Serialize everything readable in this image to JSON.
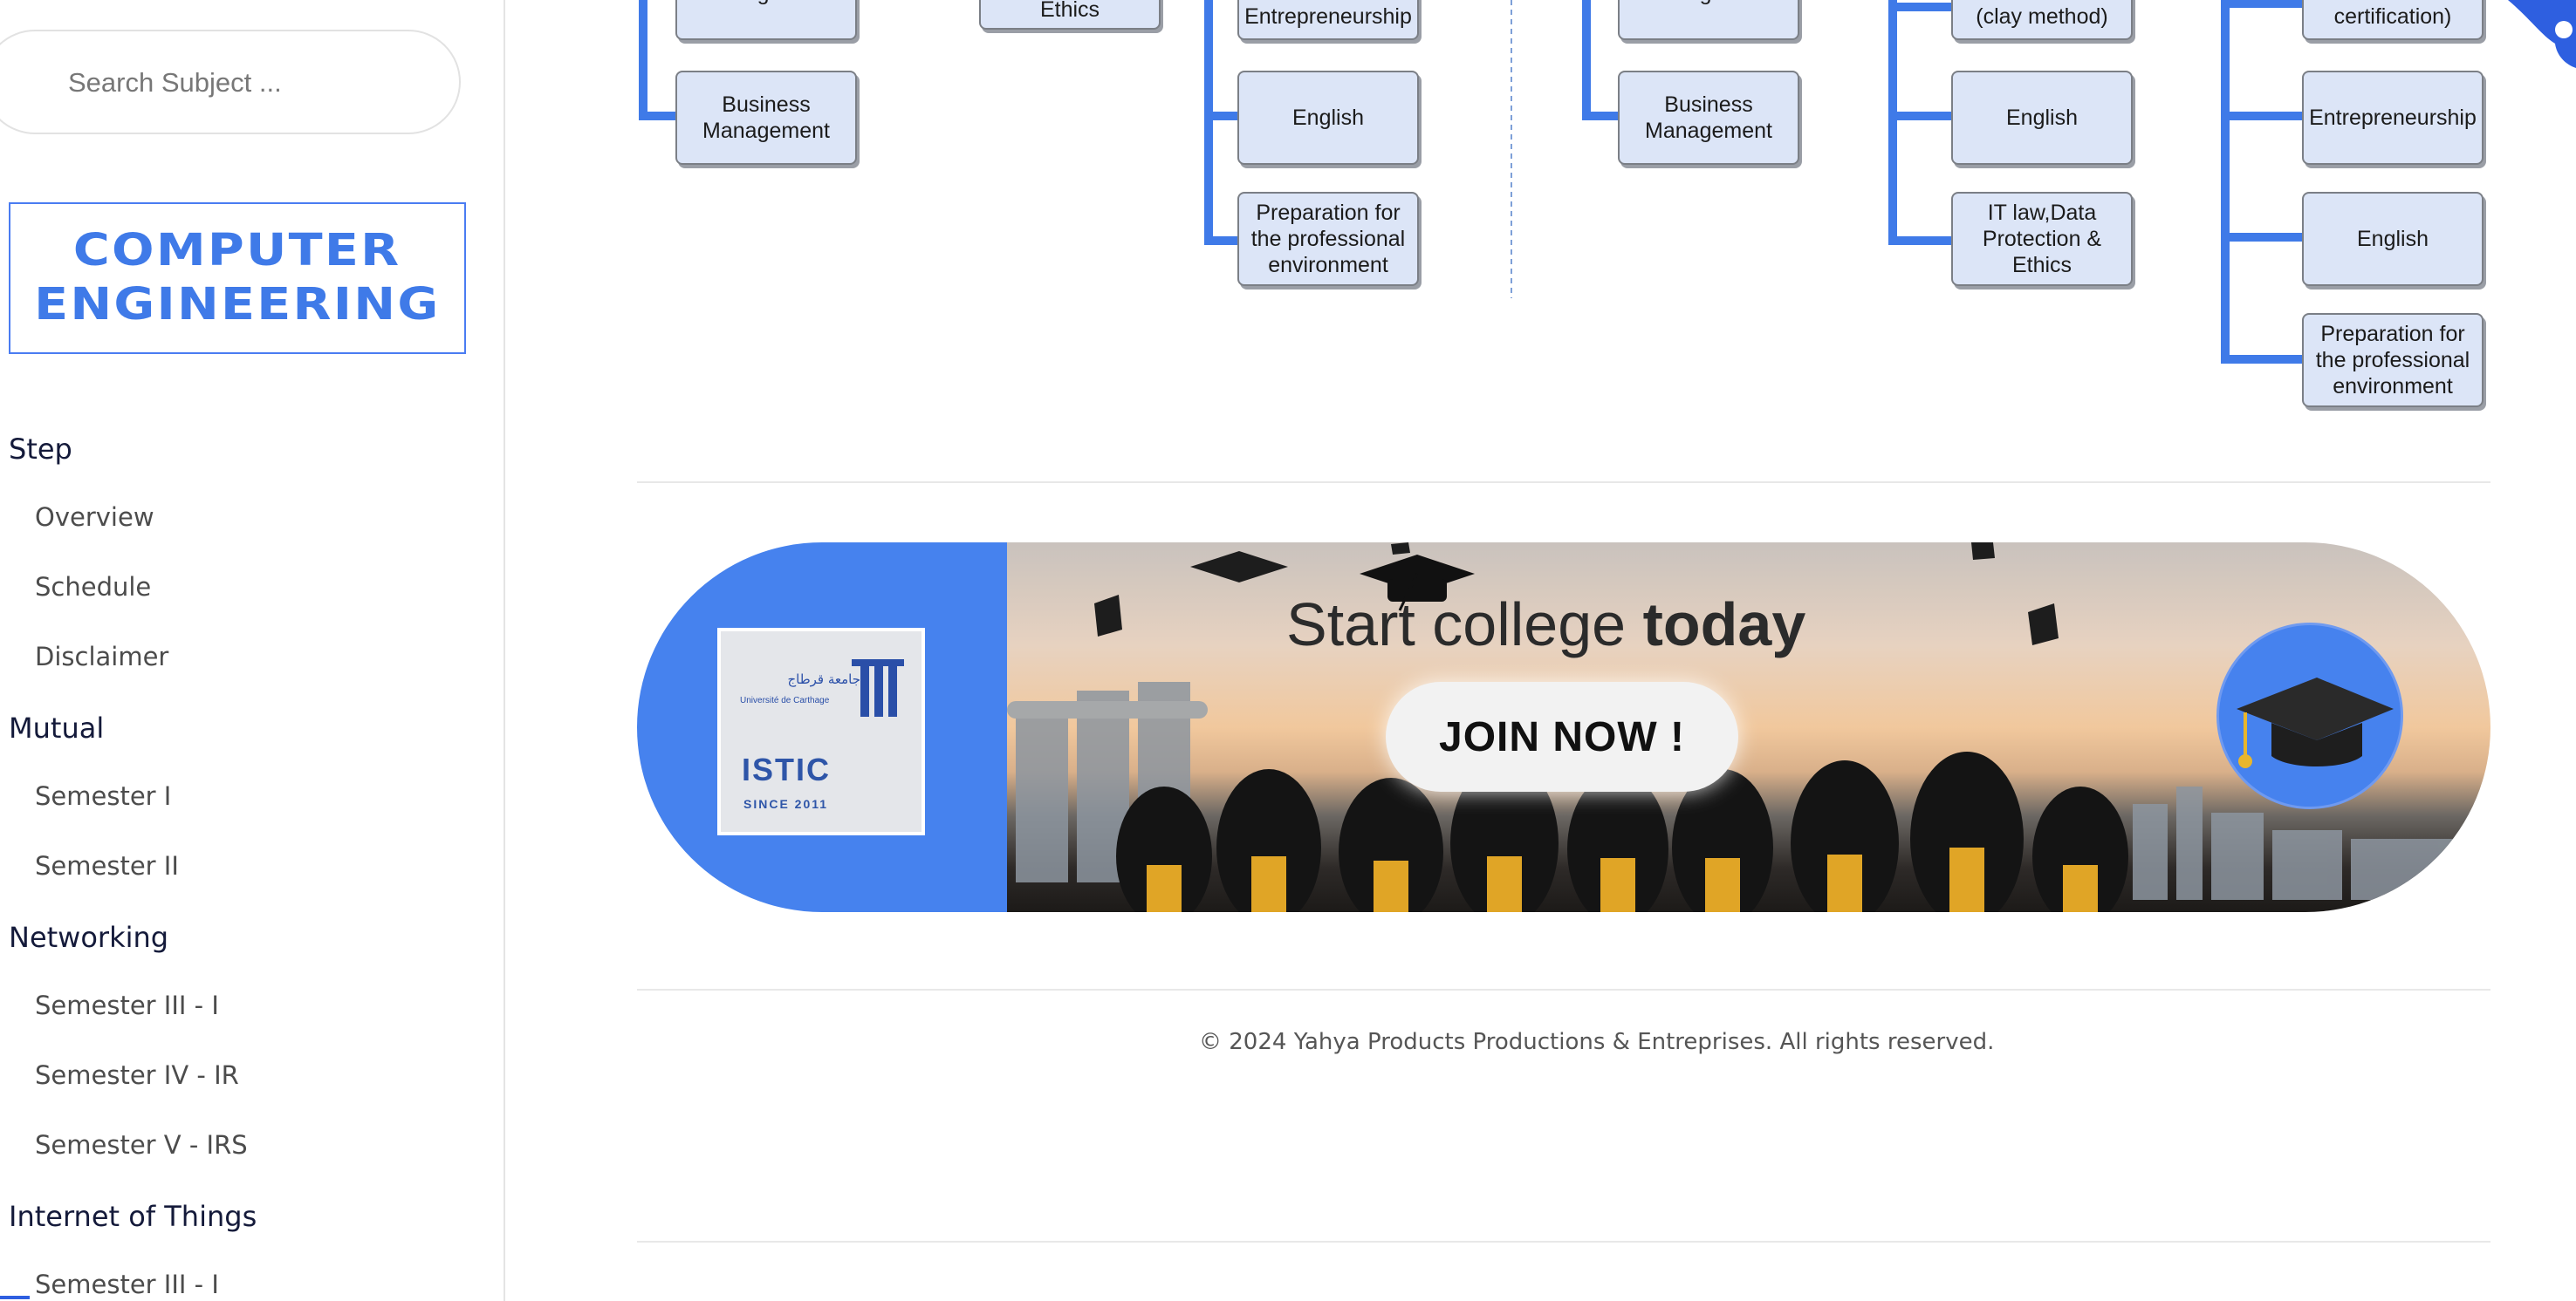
{
  "search": {
    "placeholder": "Search Subject ..."
  },
  "logo": {
    "line1": "COMPUTER",
    "line2": "ENGINEERING"
  },
  "nav": {
    "step": {
      "label": "Step",
      "items": [
        "Overview",
        "Schedule",
        "Disclaimer"
      ]
    },
    "mutual": {
      "label": "Mutual",
      "items": [
        "Semester I",
        "Semester II"
      ]
    },
    "networking": {
      "label": "Networking",
      "items": [
        "Semester III - I",
        "Semester IV - IR",
        "Semester V - IRS"
      ]
    },
    "iot": {
      "label": "Internet of Things",
      "items": [
        "Semester III - I"
      ]
    }
  },
  "diagram": {
    "boxes": {
      "c1_top": "English",
      "c1_bm": "Business Management",
      "c2_top": "Ethics",
      "c3_top": "Entrepreneurship",
      "c3_english": "English",
      "c3_prep": "Preparation for the professional environment",
      "c4_top": "English",
      "c4_bm": "Business Management",
      "c5_top": "(clay method)",
      "c5_english": "English",
      "c5_itlaw": "IT law,Data Protection & Ethics",
      "c6_top": "certification)",
      "c6_entre": "Entrepreneurship",
      "c6_english": "English",
      "c6_prep": "Preparation for the professional environment"
    }
  },
  "banner": {
    "headline_prefix": "Start college",
    "headline_bold": "today",
    "cta": "JOIN NOW !",
    "seal_arabic": "جامعة قرطاج",
    "seal_french": "Université de Carthage",
    "seal_name": "ISTIC",
    "seal_since": "SINCE 2011"
  },
  "footer": {
    "copyright": "© 2024 Yahya Products Productions & Entreprises. All rights reserved."
  },
  "colors": {
    "accent": "#4682ee",
    "nav_heading": "#141a3a",
    "box_fill": "#dce5f7",
    "connector": "#3f7ae8"
  }
}
